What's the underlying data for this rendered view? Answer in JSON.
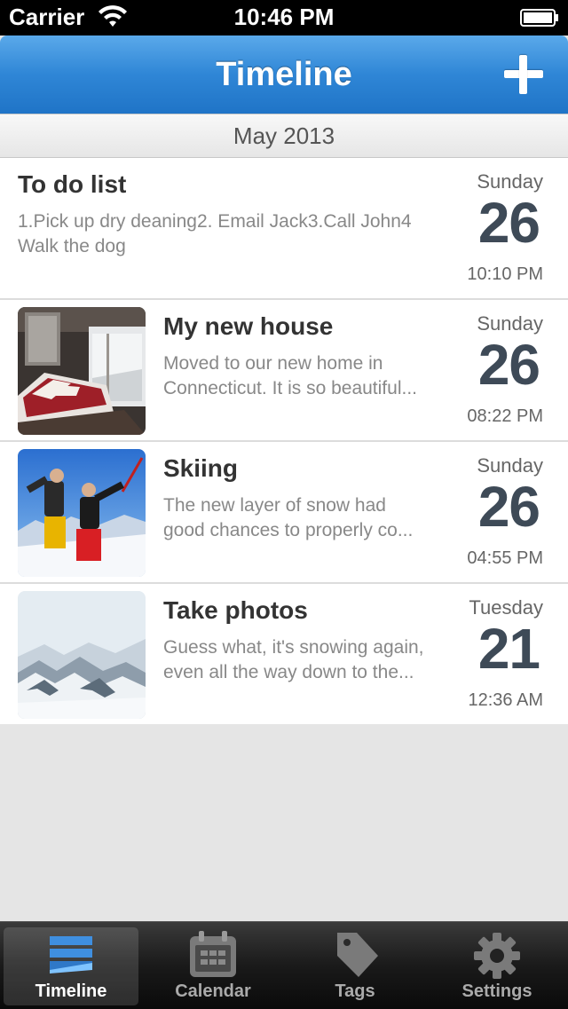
{
  "status_bar": {
    "carrier": "Carrier",
    "time": "10:46 PM"
  },
  "nav": {
    "title": "Timeline",
    "add_icon": "plus-icon"
  },
  "section": {
    "title": "May 2013"
  },
  "entries": [
    {
      "title": "To do list",
      "body": "1.Pick up dry deaning2. Email Jack3.Call John4 Walk the dog",
      "weekday": "Sunday",
      "day": "26",
      "time": "10:10 PM"
    },
    {
      "title": "My new house",
      "body_lines": [
        "Moved to our new home in",
        "Connecticut. It is so beautiful..."
      ],
      "weekday": "Sunday",
      "day": "26",
      "time": "08:22 PM",
      "image": "bedroom-photo"
    },
    {
      "title": "Skiing",
      "body_lines": [
        "The new layer of snow had",
        "good chances to properly co..."
      ],
      "weekday": "Sunday",
      "day": "26",
      "time": "04:55 PM",
      "image": "skiers-photo"
    },
    {
      "title": "Take photos",
      "body_lines": [
        "Guess what, it's snowing again,",
        "even all the way down to the..."
      ],
      "weekday": "Tuesday",
      "day": "21",
      "time": "12:36 AM",
      "image": "snowy-mountain-photo"
    }
  ],
  "tabs": [
    {
      "label": "Timeline",
      "icon": "timeline-icon",
      "active": true
    },
    {
      "label": "Calendar",
      "icon": "calendar-icon"
    },
    {
      "label": "Tags",
      "icon": "tag-icon"
    },
    {
      "label": "Settings",
      "icon": "gear-icon"
    }
  ],
  "colors": {
    "nav_blue": "#2f86d6",
    "day_number": "#3e4a57"
  }
}
